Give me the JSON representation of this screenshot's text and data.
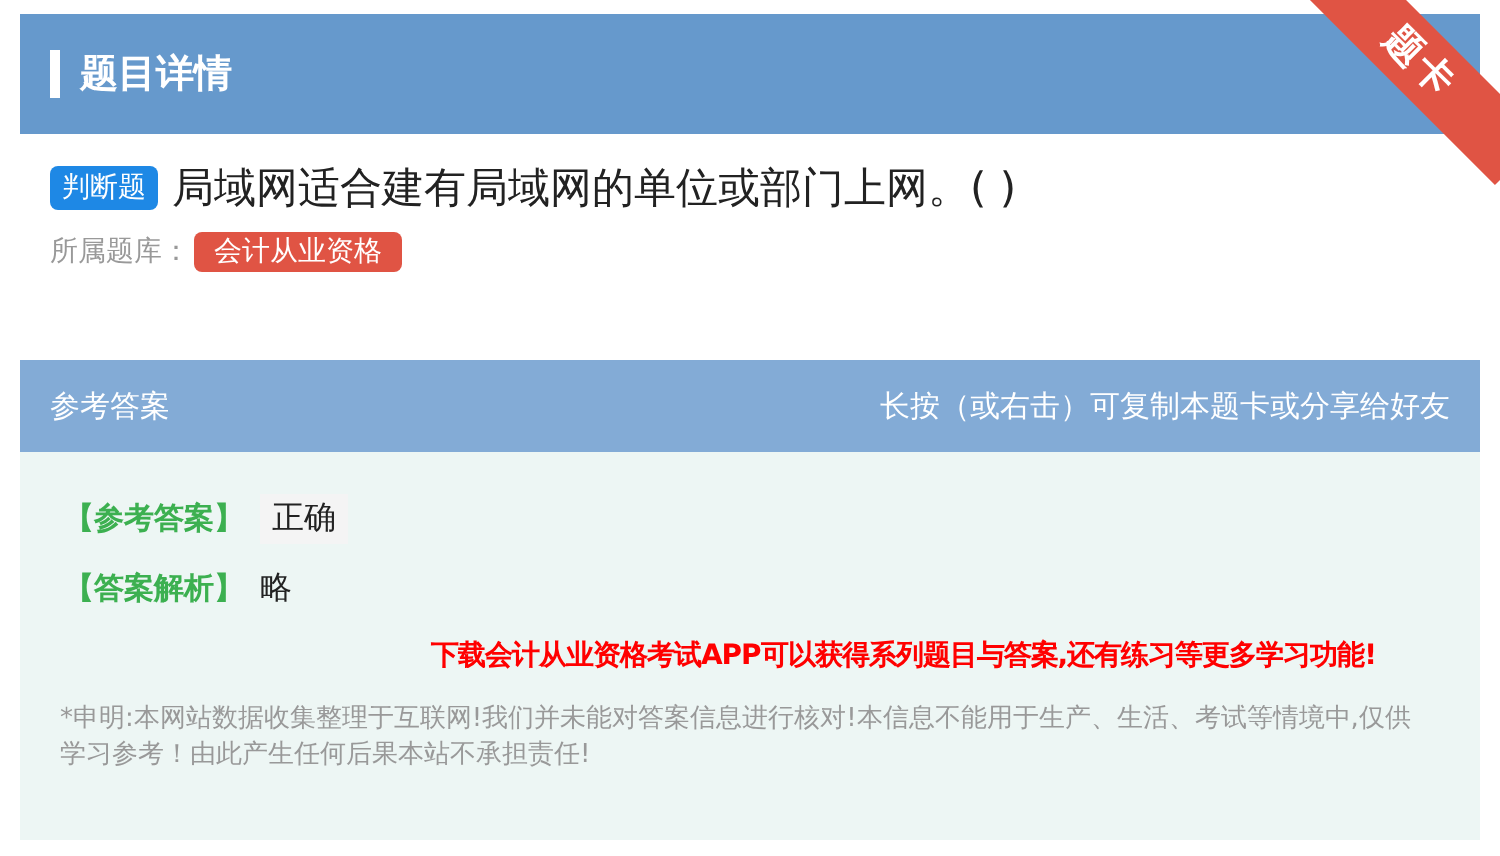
{
  "header": {
    "title": "题目详情",
    "ribbon": "题卡"
  },
  "question": {
    "type_badge": "判断题",
    "text": "局域网适合建有局域网的单位或部门上网。( )"
  },
  "source": {
    "label": "所属题库：",
    "tag": "会计从业资格"
  },
  "answer_panel": {
    "title": "参考答案",
    "hint": "长按（或右击）可复制本题卡或分享给好友",
    "answer_label": "【参考答案】",
    "answer": "正确",
    "analysis_label": "【答案解析】",
    "analysis": "略",
    "promo": "下载会计从业资格考试APP可以获得系列题目与答案,还有练习等更多学习功能!",
    "disclaimer": "*申明:本网站数据收集整理于互联网!我们并未能对答案信息进行核对!本信息不能用于生产、生活、考试等情境中,仅供学习参考！由此产生任何后果本站不承担责任!"
  }
}
